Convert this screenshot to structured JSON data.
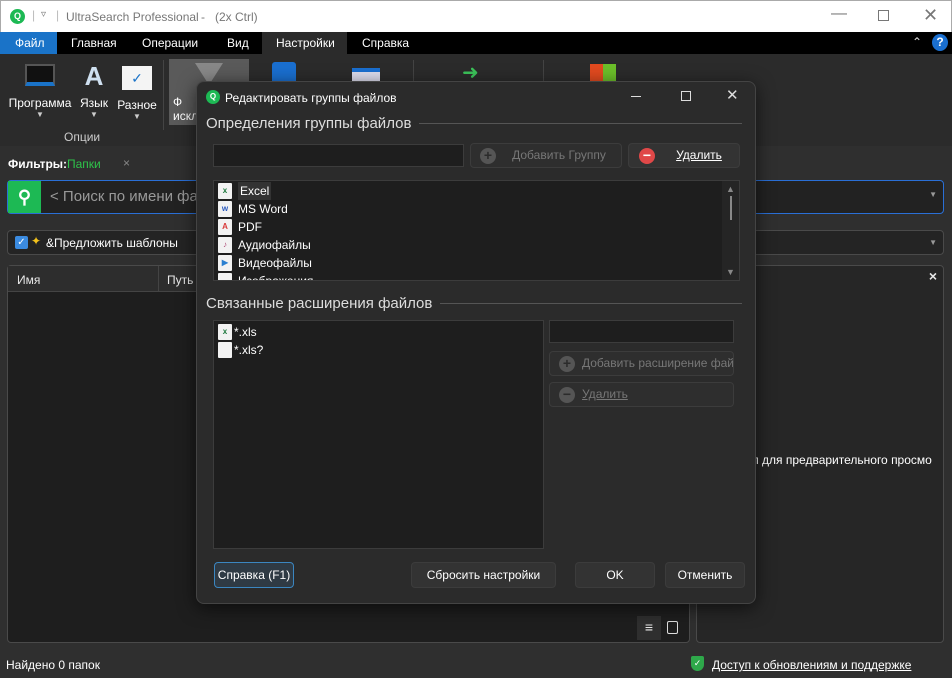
{
  "window": {
    "title": "UltraSearch Professional",
    "subtitle": "-   (2x Ctrl)"
  },
  "menu": {
    "tabs": [
      "Файл",
      "Главная",
      "Операции",
      "Вид",
      "Настройки",
      "Справка"
    ],
    "active": "Настройки"
  },
  "ribbon": {
    "program": "Программа",
    "language": "Язык",
    "misc": "Разное",
    "group_label": "Опции",
    "filter_btn_line1": "Ф",
    "filter_btn_line2": "искл"
  },
  "filters": {
    "label": "Фильтры:",
    "value": "Папки",
    "close": "×"
  },
  "search": {
    "placeholder": "< Поиск по имени фа"
  },
  "suggest": {
    "label": "&Предложить шаблоны",
    "checked": true
  },
  "table": {
    "columns": [
      "Имя",
      "Путь"
    ]
  },
  "preview": {
    "text": "йл для предварительного просмо",
    "close": "×"
  },
  "status": {
    "left": "Найдено 0 папок",
    "right": "Доступ к обновлениям и поддержке"
  },
  "dialog": {
    "title": "Редактировать группы файлов",
    "section1": "Определения группы файлов",
    "group_input": "",
    "add_group": "Добавить Группу",
    "delete": "Удалить",
    "groups": [
      {
        "name": "Excel",
        "icon": "excel-icon",
        "color": "#1f7a3e",
        "glyph": "x",
        "selected": true
      },
      {
        "name": "MS Word",
        "icon": "word-icon",
        "color": "#2b5bbf",
        "glyph": "w"
      },
      {
        "name": "PDF",
        "icon": "pdf-icon",
        "color": "#d93a3a",
        "glyph": "A"
      },
      {
        "name": "Аудиофайлы",
        "icon": "audio-icon",
        "color": "#b0507a",
        "glyph": "♪"
      },
      {
        "name": "Видеофайлы",
        "icon": "video-icon",
        "color": "#2a7fd0",
        "glyph": "▶"
      },
      {
        "name": "Изображения",
        "icon": "image-icon",
        "color": "#2a7fd0",
        "glyph": ""
      }
    ],
    "section2": "Связанные расширения файлов",
    "extensions": [
      {
        "name": "*.xls",
        "icon": "excel-icon"
      },
      {
        "name": "*.xls?",
        "icon": "file-icon"
      }
    ],
    "ext_input": "",
    "add_ext": "Добавить расширение фай",
    "delete_ext": "Удалить",
    "help": "Справка (F1)",
    "reset": "Сбросить настройки",
    "ok": "OK",
    "cancel": "Отменить"
  },
  "colors": {
    "accent": "#1a73c8",
    "green": "#1db954",
    "search_border": "#2a6fd6"
  }
}
